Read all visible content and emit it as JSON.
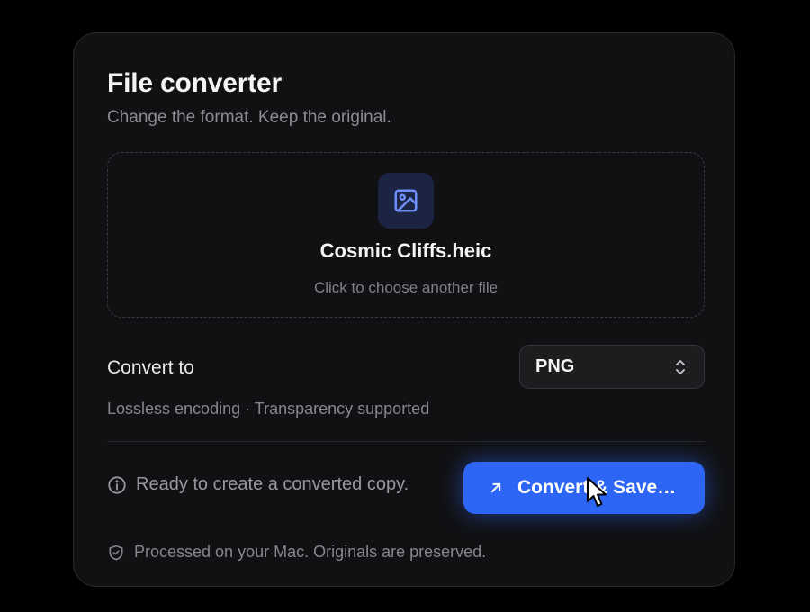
{
  "card": {
    "title": "File converter",
    "subtitle": "Change the format. Keep the original."
  },
  "file": {
    "icon": "image-icon",
    "name": "Cosmic Cliffs.heic",
    "hint": "Click to choose another file"
  },
  "conversion": {
    "label": "Convert to",
    "selected_format": "PNG",
    "format_note": "Lossless encoding · Transparency supported"
  },
  "status": {
    "icon": "info-icon",
    "text": "Ready to create a converted copy."
  },
  "primary_action": {
    "icon": "arrow-up-right-icon",
    "label": "Convert & Save…"
  },
  "footer": {
    "icon": "shield-check-icon",
    "text": "Processed on your Mac. Originals are preserved."
  },
  "colors": {
    "background": "#000000",
    "card": "#111113",
    "accent": "#2d66f5",
    "icon_accent": "#6e8ff7"
  }
}
